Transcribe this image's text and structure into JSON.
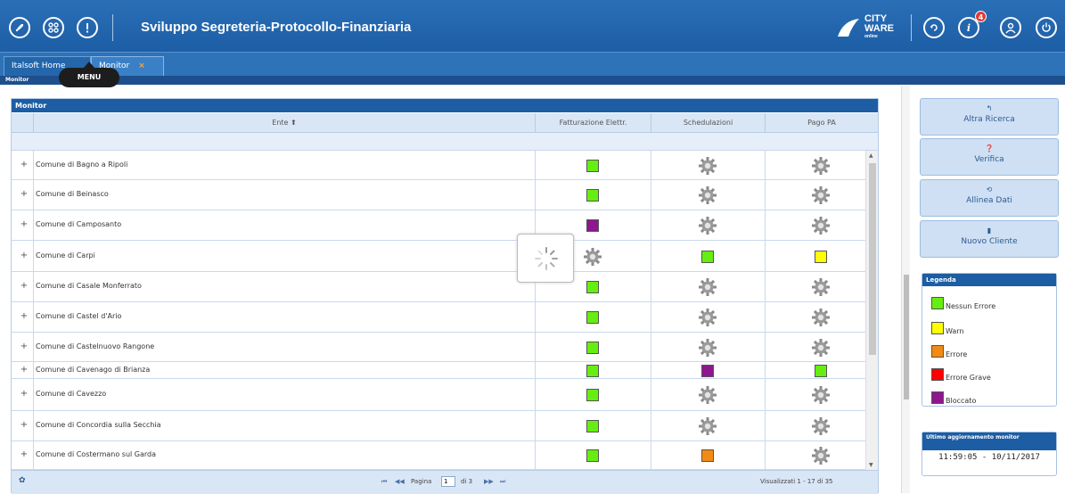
{
  "header": {
    "title": "Sviluppo Segreteria-Protocollo-Finanziaria",
    "logo_line1": "CITY",
    "logo_line2": "WARE",
    "logo_line3": "online",
    "notifications_count": "4",
    "left_icons": [
      "rocket-icon",
      "apps-grid-icon",
      "info-icon"
    ],
    "right_icons": [
      "refresh-icon",
      "notifications-icon",
      "user-icon",
      "power-icon"
    ]
  },
  "tabs": [
    {
      "label": "Italsoft Home"
    },
    {
      "label": "Monitor",
      "close": "×"
    }
  ],
  "breadcrumb": "Monitor",
  "tooltip": "MENU",
  "panel": {
    "title": "Monitor",
    "columns": {
      "ente": "Ente ⬆",
      "fatturazione": "Fatturazione Elettr.",
      "schedulazioni": "Schedulazioni",
      "pago_pa": "Pago PA"
    },
    "rows": [
      {
        "plus": "+",
        "name": "Comune di Bagno a Ripoli",
        "fatturazione": "green",
        "schedulazioni": "gear",
        "pago_pa": "gear"
      },
      {
        "plus": "+",
        "name": "Comune di Beinasco",
        "fatturazione": "green",
        "schedulazioni": "gear",
        "pago_pa": "gear"
      },
      {
        "plus": "+",
        "name": "Comune di Camposanto",
        "fatturazione": "purple",
        "schedulazioni": "gear",
        "pago_pa": "gear"
      },
      {
        "plus": "+",
        "name": "Comune di Carpi",
        "fatturazione": "gear",
        "schedulazioni": "green",
        "pago_pa": "yellow"
      },
      {
        "plus": "+",
        "name": "Comune di Casale Monferrato",
        "fatturazione": "green",
        "schedulazioni": "gear",
        "pago_pa": "gear"
      },
      {
        "plus": "+",
        "name": "Comune di Castel d'Ario",
        "fatturazione": "green",
        "schedulazioni": "gear",
        "pago_pa": "gear"
      },
      {
        "plus": "+",
        "name": "Comune di Castelnuovo Rangone",
        "fatturazione": "green",
        "schedulazioni": "gear",
        "pago_pa": "gear"
      },
      {
        "plus": "+",
        "name": "Comune di Cavenago di Brianza",
        "fatturazione": "green",
        "schedulazioni": "purple",
        "pago_pa": "green"
      },
      {
        "plus": "+",
        "name": "Comune di Cavezzo",
        "fatturazione": "green",
        "schedulazioni": "gear",
        "pago_pa": "gear"
      },
      {
        "plus": "+",
        "name": "Comune di Concordia sulla Secchia",
        "fatturazione": "green",
        "schedulazioni": "gear",
        "pago_pa": "gear"
      },
      {
        "plus": "+",
        "name": "Comune di Costermano sul Garda",
        "fatturazione": "green",
        "schedulazioni": "orange",
        "pago_pa": "gear"
      }
    ],
    "pager": {
      "first": "⏮",
      "prev": "◀◀",
      "page_label": "Pagina",
      "page_value": "1",
      "of_label": "di 3",
      "next": "▶▶",
      "last": "⏭",
      "summary": "Visualizzati 1 - 17 di 35",
      "settings_icon": "gear-icon"
    }
  },
  "sidebar": {
    "buttons": [
      {
        "icon": "undo-icon",
        "glyph": "↰",
        "label": "Altra Ricerca"
      },
      {
        "icon": "help-icon",
        "glyph": "❓",
        "label": "Verifica"
      },
      {
        "icon": "sync-icon",
        "glyph": "⟲",
        "label": "Allinea Dati"
      },
      {
        "icon": "document-icon",
        "glyph": "▮",
        "label": "Nuovo Cliente"
      }
    ],
    "legend": {
      "title": "Legenda",
      "items": [
        {
          "color": "#66ee11",
          "label": "Nessun Errore"
        },
        {
          "color": "#ffff00",
          "label": "Warn"
        },
        {
          "color": "#f28a13",
          "label": "Errore"
        },
        {
          "color": "#ff0000",
          "label": "Errore Grave"
        },
        {
          "color": "#8e168e",
          "label": "Bloccato"
        }
      ]
    },
    "last_update": {
      "title": "Ultimo aggiornamento monitor",
      "value": "11:59:05 - 10/11/2017"
    }
  },
  "colors": {
    "green": "#66ee11",
    "yellow": "#ffff00",
    "orange": "#f28a13",
    "red": "#ff0000",
    "purple": "#8e168e",
    "header_blue": "#1d5ea6"
  }
}
